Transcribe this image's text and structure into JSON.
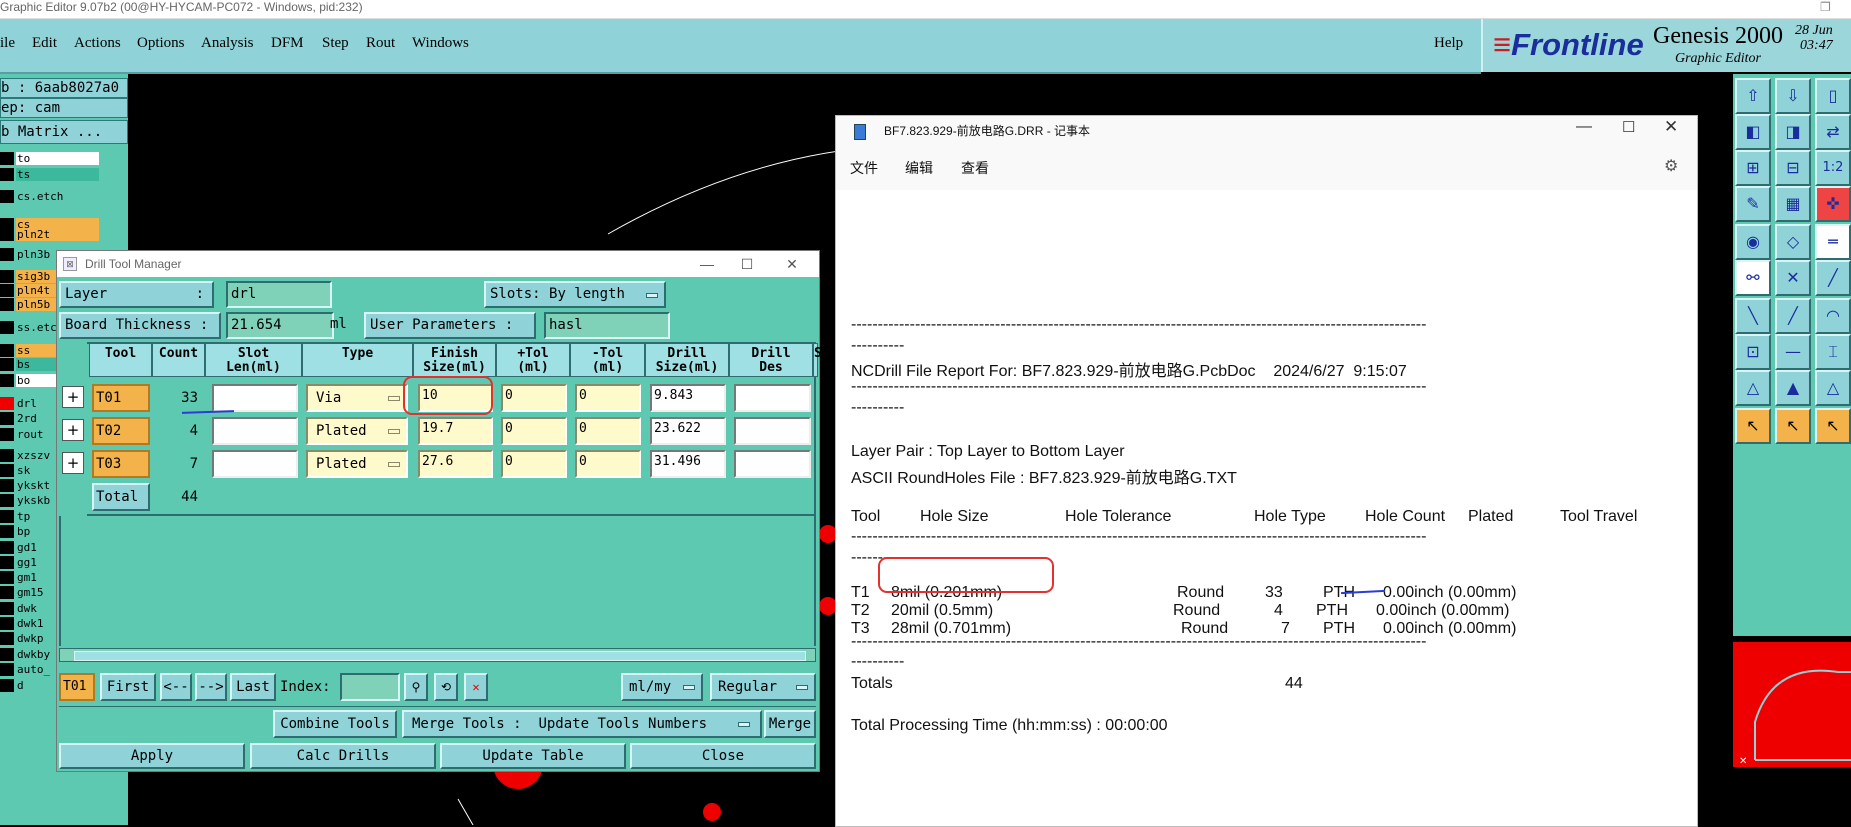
{
  "app_title": "Graphic Editor 9.07b2 (00@HY-HYCAM-PC072 - Windows, pid:232)",
  "menubar": {
    "items": [
      "ile",
      "Edit",
      "Actions",
      "Options",
      "Analysis",
      "DFM",
      "Step",
      "Rout",
      "Windows"
    ],
    "help": "Help"
  },
  "brand": {
    "frontline": "Frontline",
    "product": "Genesis 2000",
    "subtitle": "Graphic Editor",
    "date": "28 Jun",
    "time": "03:47"
  },
  "left_panel": {
    "job": "b : 6aab8027a0",
    "step": "ep: cam",
    "matrix_button": "b Matrix ...",
    "layers": [
      {
        "name": "to",
        "color": "#ffffff"
      },
      {
        "name": "ts",
        "color": "#3cb99c"
      },
      {
        "name": "cs.etch",
        "color": "#5ec9b1"
      },
      {
        "name": "cs",
        "color": "#f3b34a"
      },
      {
        "name": "pln2t",
        "color": "#f3b34a"
      },
      {
        "name": "pln3b",
        "color": "#5ec9b1"
      },
      {
        "name": "sig3b",
        "color": "#f3b34a"
      },
      {
        "name": "pln4t",
        "color": "#f3b34a"
      },
      {
        "name": "pln5b",
        "color": "#f3b34a"
      },
      {
        "name": "ss.etc",
        "color": "#5ec9b1"
      },
      {
        "name": "ss",
        "color": "#f3b34a"
      },
      {
        "name": "bs",
        "color": "#3cb99c"
      },
      {
        "name": "bo",
        "color": "#ffffff"
      },
      {
        "name": "drl",
        "color": "#5ec9b1"
      },
      {
        "name": "2rd",
        "color": "#5ec9b1"
      },
      {
        "name": "rout",
        "color": "#5ec9b1"
      },
      {
        "name": "xzszv",
        "color": "#5ec9b1"
      },
      {
        "name": "sk",
        "color": "#5ec9b1"
      },
      {
        "name": "ykskt",
        "color": "#5ec9b1"
      },
      {
        "name": "ykskb",
        "color": "#5ec9b1"
      },
      {
        "name": "tp",
        "color": "#5ec9b1"
      },
      {
        "name": "bp",
        "color": "#5ec9b1"
      },
      {
        "name": "gd1",
        "color": "#5ec9b1"
      },
      {
        "name": "gg1",
        "color": "#5ec9b1"
      },
      {
        "name": "gm1",
        "color": "#5ec9b1"
      },
      {
        "name": "gm15",
        "color": "#5ec9b1"
      },
      {
        "name": "dwk",
        "color": "#5ec9b1"
      },
      {
        "name": "dwk1",
        "color": "#5ec9b1"
      },
      {
        "name": "dwkp",
        "color": "#5ec9b1"
      },
      {
        "name": "dwkby",
        "color": "#5ec9b1"
      },
      {
        "name": "auto_",
        "color": "#5ec9b1"
      },
      {
        "name": "d",
        "color": "#5ec9b1"
      }
    ]
  },
  "drill_tool_manager": {
    "title": "Drill Tool Manager",
    "layer_label": "Layer",
    "layer_sep": ":",
    "layer_value": "drl",
    "slots_label": "Slots:",
    "slots_value": "By length",
    "board_thickness_label": "Board Thickness :",
    "board_thickness_value": "21.654",
    "board_thickness_unit": "ml",
    "user_params_label": "User Parameters :",
    "user_params_value": "hasl",
    "columns": [
      "Tool",
      "Count",
      "Slot\nLen(ml)",
      "Type",
      "Finish\nSize(ml)",
      "+Tol\n(ml)",
      "-Tol\n(ml)",
      "Drill\nSize(ml)",
      "Drill\nDes",
      "S"
    ],
    "rows": [
      {
        "tool": "T01",
        "count": "33",
        "slot_len": "",
        "type": "Via",
        "finish": "10",
        "ptol": "0",
        "ntol": "0",
        "drill": "9.843",
        "des": ""
      },
      {
        "tool": "T02",
        "count": "4",
        "slot_len": "",
        "type": "Plated",
        "finish": "19.7",
        "ptol": "0",
        "ntol": "0",
        "drill": "23.622",
        "des": ""
      },
      {
        "tool": "T03",
        "count": "7",
        "slot_len": "",
        "type": "Plated",
        "finish": "27.6",
        "ptol": "0",
        "ntol": "0",
        "drill": "31.496",
        "des": ""
      }
    ],
    "total_label": "Total",
    "total_count": "44",
    "nav": {
      "current_tool": "T01",
      "first": "First",
      "prev": "<--",
      "next": "-->",
      "last": "Last",
      "index_label": "Index:",
      "units": "ml/my",
      "mode": "Regular"
    },
    "actions": {
      "combine": "Combine Tools",
      "merge_tools": "Merge Tools :",
      "update_numbers": "Update Tools Numbers",
      "merge": "Merge",
      "apply": "Apply",
      "calc": "Calc Drills",
      "update_table": "Update Table",
      "close": "Close"
    }
  },
  "notepad": {
    "title": "BF7.823.929-前放电路G.DRR - 记事本",
    "menu": [
      "文件",
      "编辑",
      "查看"
    ],
    "dash_line": "------------------------------------------------------------------------------------------------------------",
    "dash_short": "----------",
    "report_header": "NCDrill File Report For: BF7.823.929-前放电路G.PcbDoc    2024/6/27  9:15:07",
    "layer_pair": "Layer Pair : Top Layer to Bottom Layer",
    "ascii_file": "ASCII RoundHoles File : BF7.823.929-前放电路G.TXT",
    "col_headers": [
      "Tool",
      "Hole Size",
      "Hole Tolerance",
      "Hole Type",
      "Hole Count",
      "Plated",
      "Tool Travel"
    ],
    "rows": [
      {
        "tool": "T1",
        "size": "8mil (0.201mm)",
        "type": "Round",
        "count": "33",
        "plated": "PTH",
        "travel": "0.00inch (0.00mm)"
      },
      {
        "tool": "T2",
        "size": "20mil (0.5mm)",
        "type": "Round",
        "count": "4",
        "plated": "PTH",
        "travel": "0.00inch (0.00mm)"
      },
      {
        "tool": "T3",
        "size": "28mil (0.701mm)",
        "type": "Round",
        "count": "7",
        "plated": "PTH",
        "travel": "0.00inch (0.00mm)"
      }
    ],
    "totals_label": "Totals",
    "totals_value": "44",
    "processing": "Total Processing Time (hh:mm:ss) : 00:00:00"
  },
  "right_toolbar": {
    "icons": [
      "up-arrow-icon",
      "down-arrow-icon",
      "fit-icon",
      "left-frame-icon",
      "right-frame-icon",
      "swap-icon",
      "zoom-in-icon",
      "zoom-out-icon",
      "one-to-two-icon",
      "tools-icon",
      "grid-icon",
      "snap-icon",
      "circle-pad-icon",
      "shape-icon",
      "ruler-icon",
      "connect-icon",
      "cross-icon",
      "line-icon",
      "line-draw-icon",
      "diagonal-icon",
      "arc-icon",
      "pad-icon",
      "minus-icon",
      "bracket-icon",
      "triangle-icon",
      "triangle-a-icon",
      "triangle-b-icon",
      "pointer-icon",
      "select-pointer-icon",
      "select-box-icon"
    ],
    "one_to_two": "1:2"
  }
}
